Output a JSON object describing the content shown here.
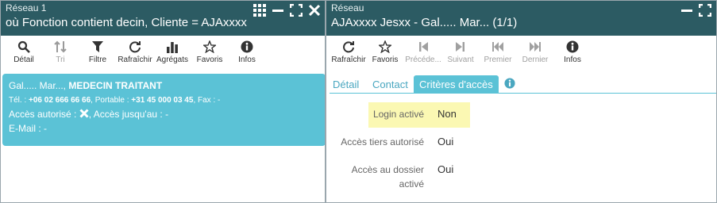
{
  "left": {
    "title": "Réseau 1",
    "subtitle": "où Fonction contient decin, Cliente = AJAxxxx",
    "toolbar": [
      {
        "label": "Détail",
        "icon": "search-icon",
        "enabled": true
      },
      {
        "label": "Tri",
        "icon": "sort-icon",
        "enabled": false
      },
      {
        "label": "Filtre",
        "icon": "filter-icon",
        "enabled": true
      },
      {
        "label": "Rafraîchir",
        "icon": "refresh-icon",
        "enabled": true
      },
      {
        "label": "Agrégats",
        "icon": "bar-chart-icon",
        "enabled": true
      },
      {
        "label": "Favoris",
        "icon": "star-icon",
        "enabled": true
      },
      {
        "label": "Infos",
        "icon": "info-icon",
        "enabled": true
      }
    ],
    "card": {
      "name": "Gal..... Mar...,",
      "role": "MEDECIN TRAITANT",
      "tel_label": "Tél. :",
      "tel_value": "+06 02 666 66 66",
      "portable_label": ", Portable :",
      "portable_value": "+31 45 000 03 45",
      "fax_label": ", Fax : -",
      "acces_label": "Accès autorisé :",
      "acces_jusqu": ", Accès jusqu'au : -",
      "email_label": "E-Mail : -"
    }
  },
  "right": {
    "title": "Réseau",
    "subtitle": "AJAxxxx Jesxx - Gal..... Mar... (1/1)",
    "toolbar": [
      {
        "label": "Rafraîchir",
        "icon": "refresh-icon",
        "enabled": true
      },
      {
        "label": "Favoris",
        "icon": "star-icon",
        "enabled": true
      },
      {
        "label": "Précéde...",
        "icon": "first-icon",
        "enabled": false
      },
      {
        "label": "Suivant",
        "icon": "next-icon",
        "enabled": false
      },
      {
        "label": "Premier",
        "icon": "rewind-icon",
        "enabled": false
      },
      {
        "label": "Dernier",
        "icon": "fast-forward-icon",
        "enabled": false
      },
      {
        "label": "Infos",
        "icon": "info-icon",
        "enabled": true
      }
    ],
    "tabs": [
      "Détail",
      "Contact",
      "Critères d'accès"
    ],
    "fields": [
      {
        "label": "Login activé",
        "value": "Non"
      },
      {
        "label": "Accès tiers autorisé",
        "value": "Oui"
      },
      {
        "label_l1": "Accès au dossier",
        "label_l2": "activé",
        "value": "Oui"
      }
    ]
  }
}
